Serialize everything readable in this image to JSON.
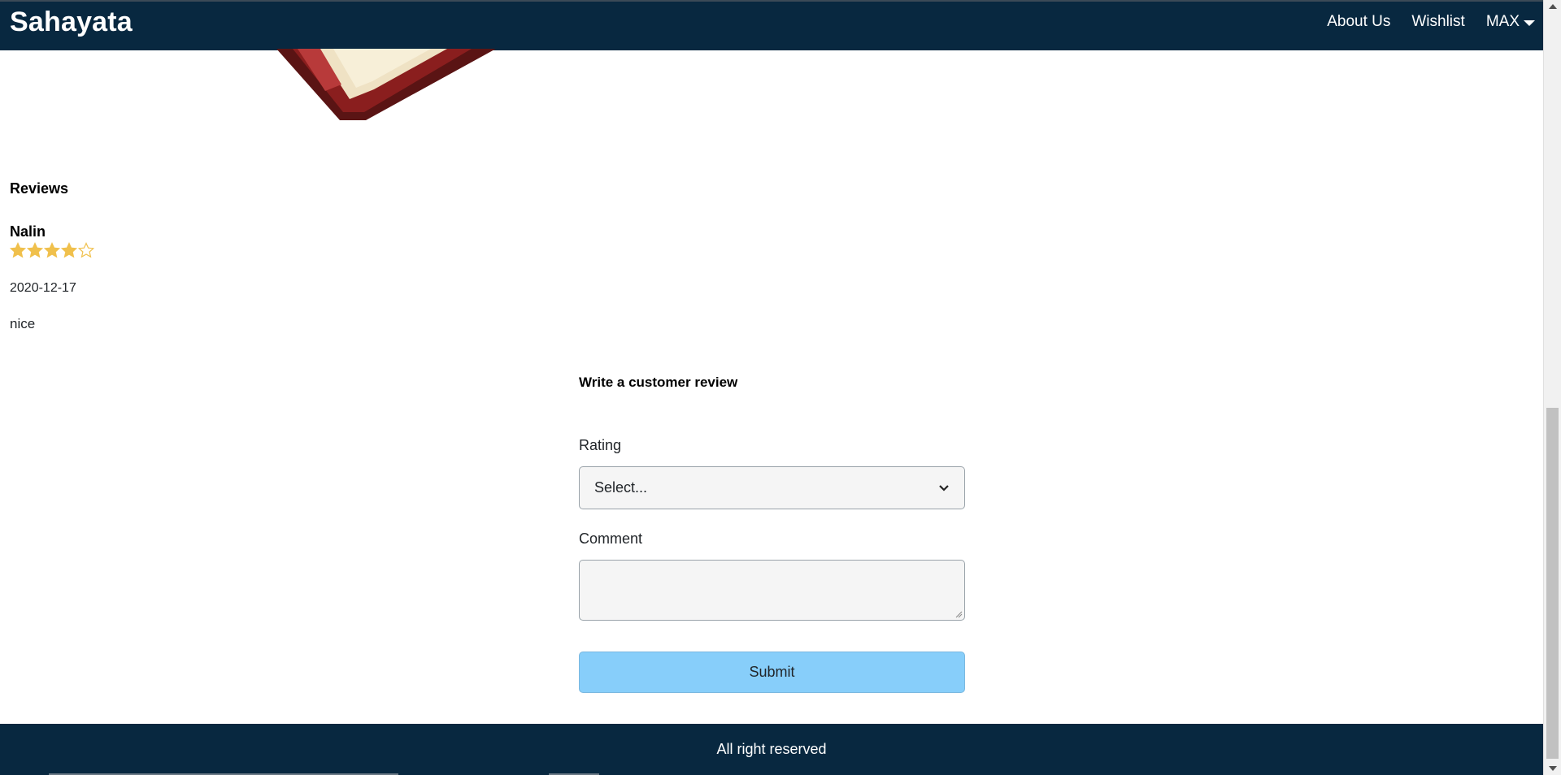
{
  "navbar": {
    "brand": "Sahayata",
    "links": [
      "About Us",
      "Wishlist"
    ],
    "user": "MAX"
  },
  "reviews": {
    "heading": "Reviews",
    "items": [
      {
        "author": "Nalin",
        "rating": 4,
        "max_rating": 5,
        "date": "2020-12-17",
        "comment": "nice"
      }
    ]
  },
  "review_form": {
    "heading": "Write a customer review",
    "rating_label": "Rating",
    "rating_selected": "Select...",
    "comment_label": "Comment",
    "comment_value": "",
    "submit_label": "Submit"
  },
  "footer": {
    "text": "All right reserved"
  },
  "colors": {
    "navbar_bg": "#082840",
    "star": "#f0c04c",
    "submit_bg": "#87cefa"
  },
  "icons": [
    "caret-down-icon",
    "star-filled-icon",
    "star-empty-icon",
    "select-arrow-icon"
  ]
}
